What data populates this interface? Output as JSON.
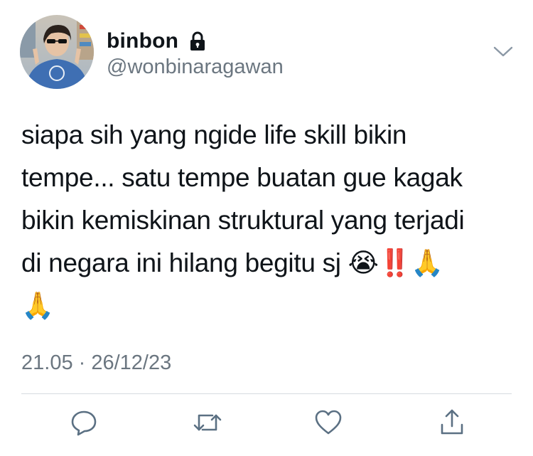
{
  "tweet": {
    "display_name": "binbon",
    "handle": "@wonbinaragawan",
    "text": "siapa sih yang ngide life skill bikin\ntempe... satu tempe buatan gue kagak\nbikin kemiskinan struktural yang terjadi\ndi negara ini hilang begitu sj 😭‼️🙏\n🙏",
    "timestamp": "21.05 · 26/12/23",
    "protected": true
  },
  "icons": {
    "lock": "lock-icon",
    "menu": "chevron-down-icon",
    "reply": "reply-icon",
    "retweet": "retweet-icon",
    "like": "heart-icon",
    "share": "share-icon"
  },
  "colors": {
    "text_primary": "#0f1419",
    "text_secondary": "#6b7680",
    "icon": "#5b7083",
    "divider": "#d6dbe0"
  }
}
